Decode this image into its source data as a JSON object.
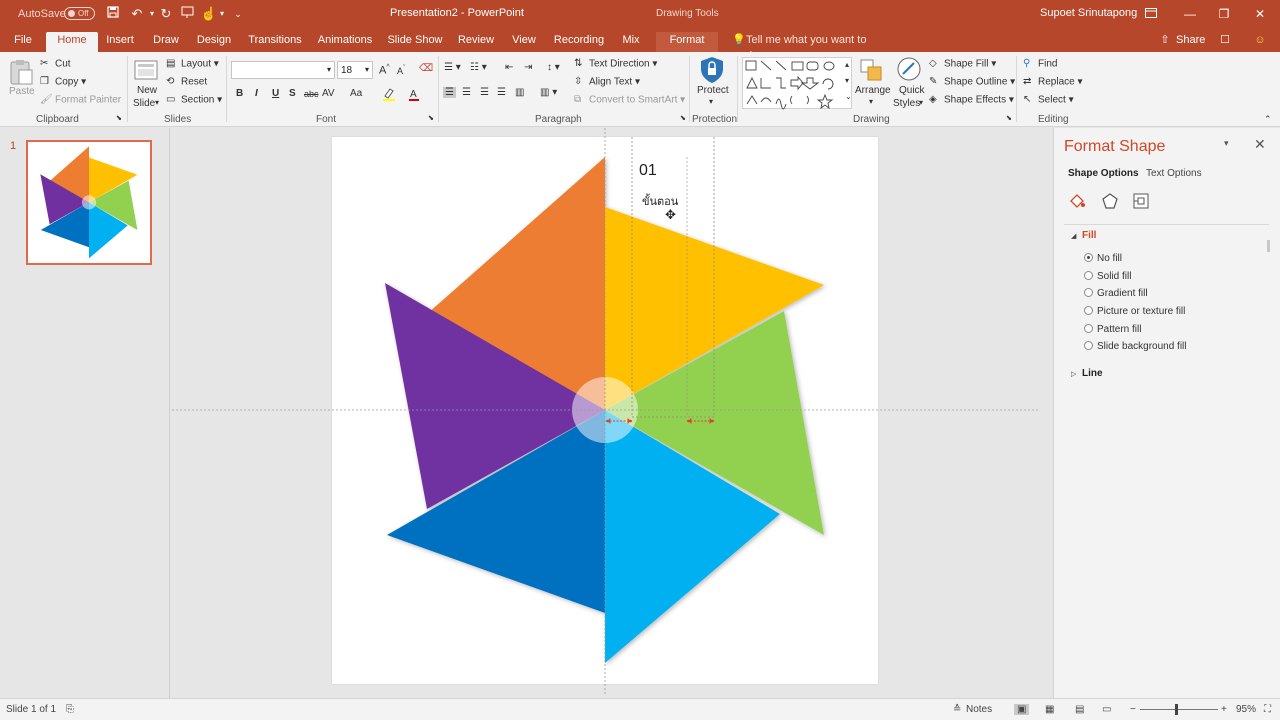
{
  "titlebar": {
    "autosave_label": "AutoSave",
    "autosave_state": "Off",
    "document_title": "Presentation2  -  PowerPoint",
    "contextual_tools": "Drawing Tools",
    "user_name": "Supoet Srinutapong"
  },
  "tabs": {
    "file": "File",
    "home": "Home",
    "insert": "Insert",
    "draw": "Draw",
    "design": "Design",
    "transitions": "Transitions",
    "animations": "Animations",
    "slide_show": "Slide Show",
    "review": "Review",
    "view": "View",
    "recording": "Recording",
    "mix": "Mix",
    "format": "Format",
    "tell_me": "Tell me what you want to do",
    "share": "Share"
  },
  "ribbon": {
    "clipboard": {
      "paste": "Paste",
      "cut": "Cut",
      "copy": "Copy",
      "format_painter": "Format Painter",
      "group": "Clipboard"
    },
    "slides": {
      "new_slide_line1": "New",
      "new_slide_line2": "Slide",
      "layout": "Layout",
      "reset": "Reset",
      "section": "Section",
      "group": "Slides"
    },
    "font": {
      "font_name": "",
      "font_size": "18",
      "group": "Font",
      "bold": "B",
      "italic": "I",
      "underline": "U",
      "shadow": "S",
      "strike": "abc",
      "spacing": "AV",
      "case": "Aa",
      "grow": "A",
      "shrink": "A"
    },
    "paragraph": {
      "text_direction": "Text Direction",
      "align_text": "Align Text",
      "smartart": "Convert to SmartArt",
      "group": "Paragraph"
    },
    "protection": {
      "protect": "Protect",
      "group": "Protection"
    },
    "drawing": {
      "arrange": "Arrange",
      "quick_styles_line1": "Quick",
      "quick_styles_line2": "Styles",
      "shape_fill": "Shape Fill",
      "shape_outline": "Shape Outline",
      "shape_effects": "Shape Effects",
      "group": "Drawing"
    },
    "editing": {
      "find": "Find",
      "replace": "Replace",
      "select": "Select",
      "group": "Editing"
    }
  },
  "thumbnails": [
    {
      "number": "1"
    }
  ],
  "slide": {
    "number_text": "01",
    "sub_text": "ขั้นตอน",
    "pinwheel_colors": {
      "orange": "#ed7d31",
      "yellow": "#ffc000",
      "green": "#92d050",
      "cyan": "#00b0f0",
      "blue": "#0070c0",
      "purple": "#7030a0"
    }
  },
  "format_pane": {
    "title": "Format Shape",
    "tab_shape": "Shape Options",
    "tab_text": "Text Options",
    "fill_section": "Fill",
    "line_section": "Line",
    "fill_options": [
      {
        "label": "No fill",
        "selected": true
      },
      {
        "label": "Solid fill",
        "selected": false
      },
      {
        "label": "Gradient fill",
        "selected": false
      },
      {
        "label": "Picture or texture fill",
        "selected": false
      },
      {
        "label": "Pattern fill",
        "selected": false
      },
      {
        "label": "Slide background fill",
        "selected": false
      }
    ]
  },
  "statusbar": {
    "slide_info": "Slide 1 of 1",
    "notes": "Notes",
    "zoom": "95%"
  },
  "accent_color": "#b7472a"
}
